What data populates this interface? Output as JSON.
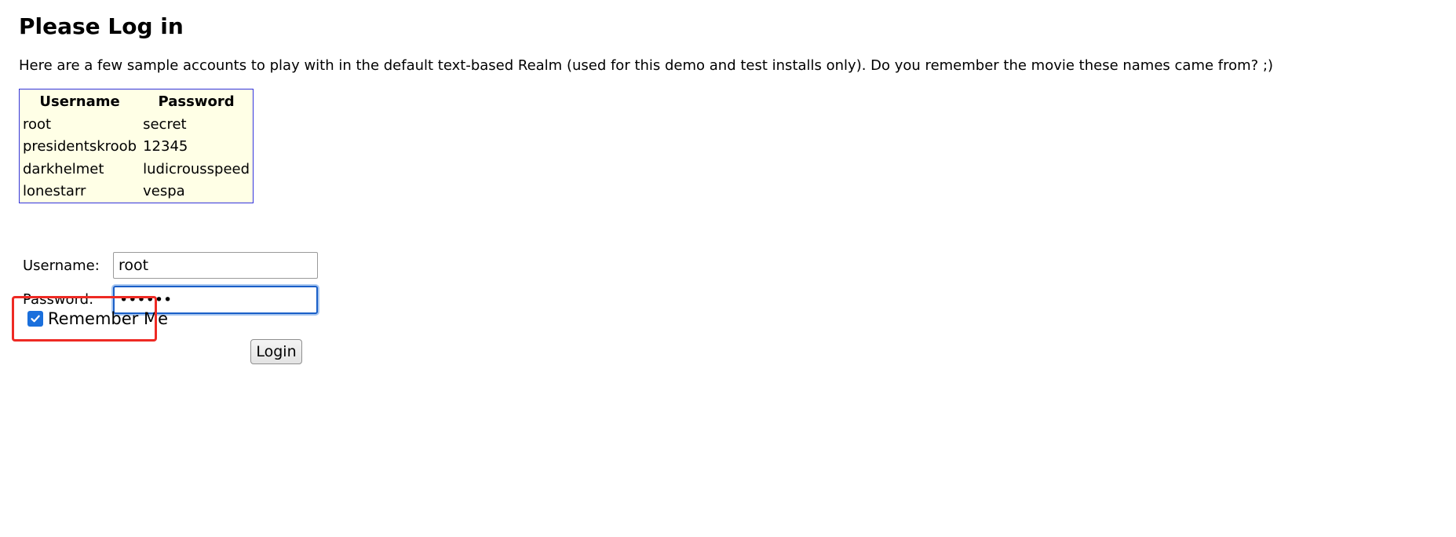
{
  "page": {
    "title": "Please Log in",
    "intro": "Here are a few sample accounts to play with in the default text-based Realm (used for this demo and test installs only). Do you remember the movie these names came from? ;)"
  },
  "accounts_table": {
    "headers": [
      "Username",
      "Password"
    ],
    "rows": [
      [
        "root",
        "secret"
      ],
      [
        "presidentskroob",
        "12345"
      ],
      [
        "darkhelmet",
        "ludicrousspeed"
      ],
      [
        "lonestarr",
        "vespa"
      ]
    ]
  },
  "form": {
    "username_label": "Username:",
    "username_value": "root",
    "password_label": "Password:",
    "password_value": "secret",
    "remember_label": "Remember Me",
    "remember_checked": true,
    "login_label": "Login"
  },
  "colors": {
    "table_border": "#3333dd",
    "table_background": "#ffffe6",
    "checkbox_accent": "#1a6fdc",
    "focus_ring": "#1a5fc8",
    "highlight": "#ee2a24"
  }
}
